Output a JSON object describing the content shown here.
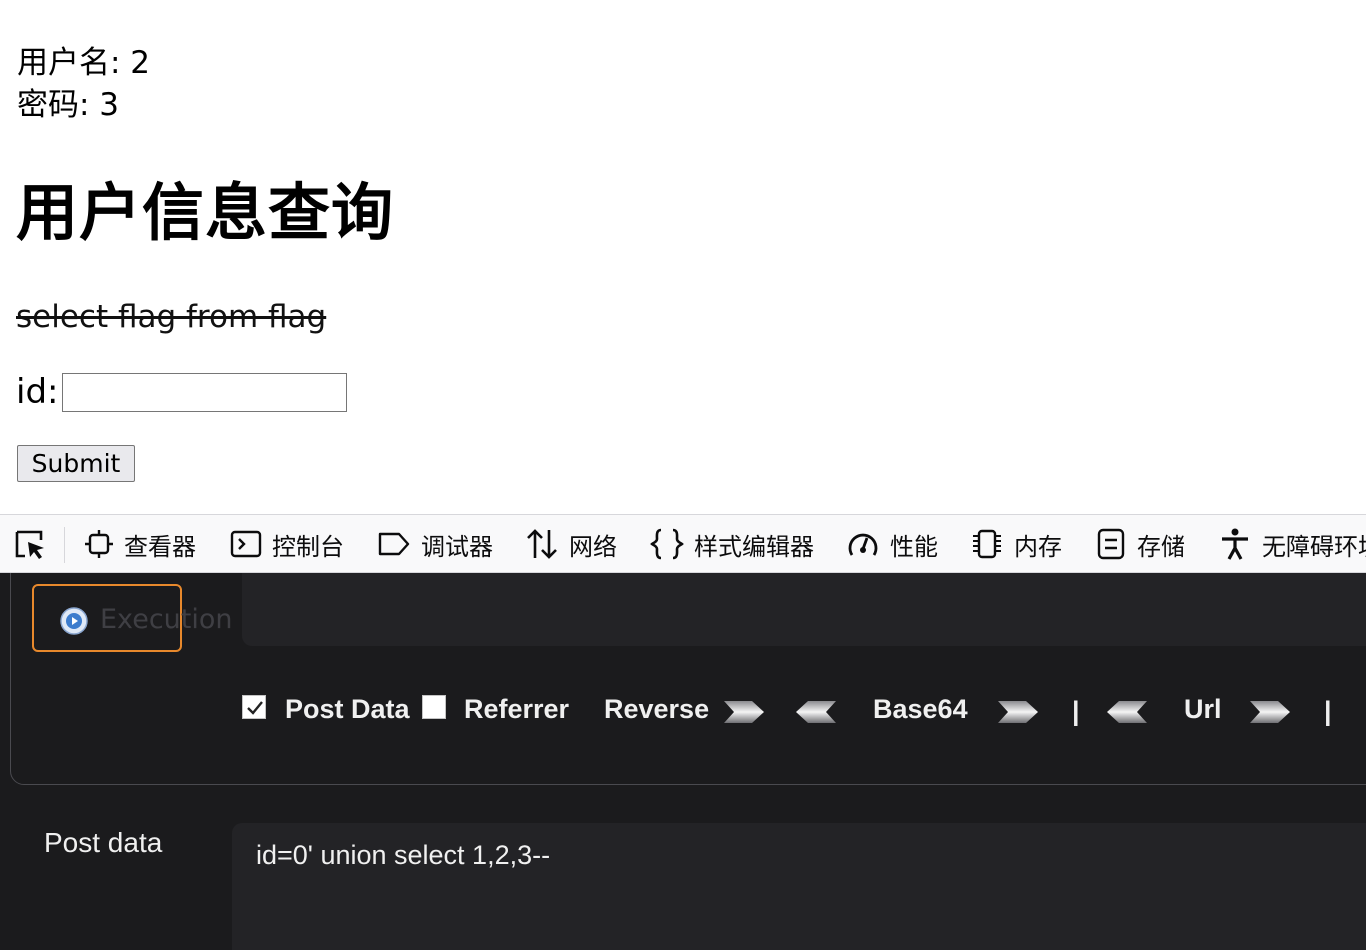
{
  "page": {
    "username_line": "用户名: 2",
    "password_line": "密码: 3",
    "heading": "用户信息查询",
    "hint_struck": "select flag from flag",
    "id_label": "id:",
    "id_value": "",
    "submit_label": "Submit"
  },
  "devtools": {
    "tabs": [
      {
        "label": "查看器",
        "icon": "inspector-icon"
      },
      {
        "label": "控制台",
        "icon": "console-icon"
      },
      {
        "label": "调试器",
        "icon": "debugger-icon"
      },
      {
        "label": "网络",
        "icon": "network-icon"
      },
      {
        "label": "样式编辑器",
        "icon": "style-editor-icon"
      },
      {
        "label": "性能",
        "icon": "performance-icon"
      },
      {
        "label": "内存",
        "icon": "memory-icon"
      },
      {
        "label": "存储",
        "icon": "storage-icon"
      },
      {
        "label": "无障碍环境",
        "icon": "accessibility-icon"
      }
    ]
  },
  "hackbar": {
    "execute_label": "Execution",
    "post_data_checkbox": {
      "label": "Post Data",
      "checked": true
    },
    "referrer_checkbox": {
      "label": "Referrer",
      "checked": false
    },
    "reverse_label": "Reverse",
    "base64_label": "Base64",
    "url_label": "Url",
    "separator": "|",
    "post_data_label": "Post data",
    "post_data_value": "id=0' union select 1,2,3--"
  },
  "colors": {
    "panel_bg": "#1b1b1d",
    "field_bg": "#232326",
    "execute_border": "#e8892c"
  }
}
